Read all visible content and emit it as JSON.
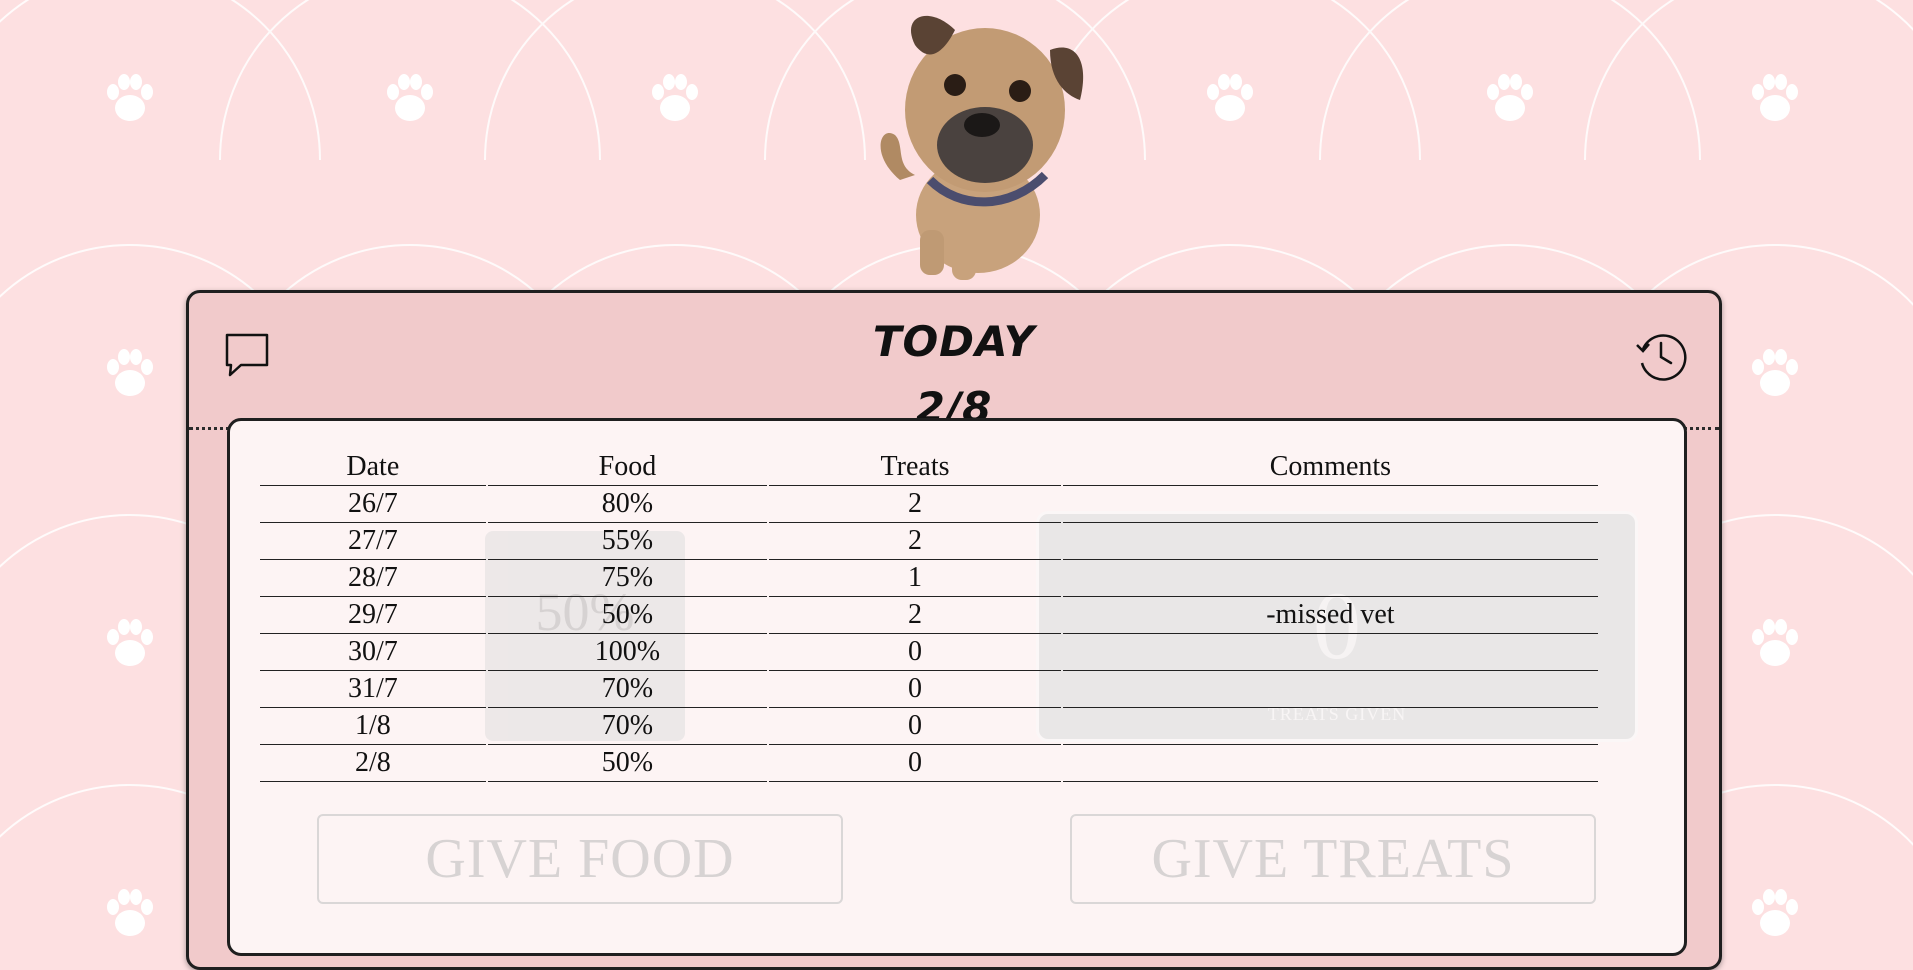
{
  "header": {
    "title": "TODAY",
    "date": "2/8"
  },
  "icons": {
    "comments": "speech-bubble-icon",
    "history": "clock-history-icon"
  },
  "log": {
    "columns": [
      "Date",
      "Food",
      "Treats",
      "Comments"
    ],
    "rows": [
      {
        "date": "26/7",
        "food": "80%",
        "treats": "2",
        "comment": ""
      },
      {
        "date": "27/7",
        "food": "55%",
        "treats": "2",
        "comment": ""
      },
      {
        "date": "28/7",
        "food": "75%",
        "treats": "1",
        "comment": ""
      },
      {
        "date": "29/7",
        "food": "50%",
        "treats": "2",
        "comment": "-missed vet"
      },
      {
        "date": "30/7",
        "food": "100%",
        "treats": "0",
        "comment": ""
      },
      {
        "date": "31/7",
        "food": "70%",
        "treats": "0",
        "comment": ""
      },
      {
        "date": "1/8",
        "food": "70%",
        "treats": "0",
        "comment": ""
      },
      {
        "date": "2/8",
        "food": "50%",
        "treats": "0",
        "comment": ""
      }
    ]
  },
  "background_panel": {
    "food_level": "50%",
    "treats_count": "0",
    "treats_caption": "TREATS GIVEN"
  },
  "actions": {
    "give_food": "GIVE FOOD",
    "give_treats": "GIVE TREATS"
  },
  "colors": {
    "page_bg": "#fde0e1",
    "card_bg": "#f1cacb",
    "panel_bg": "#fdf4f4"
  }
}
